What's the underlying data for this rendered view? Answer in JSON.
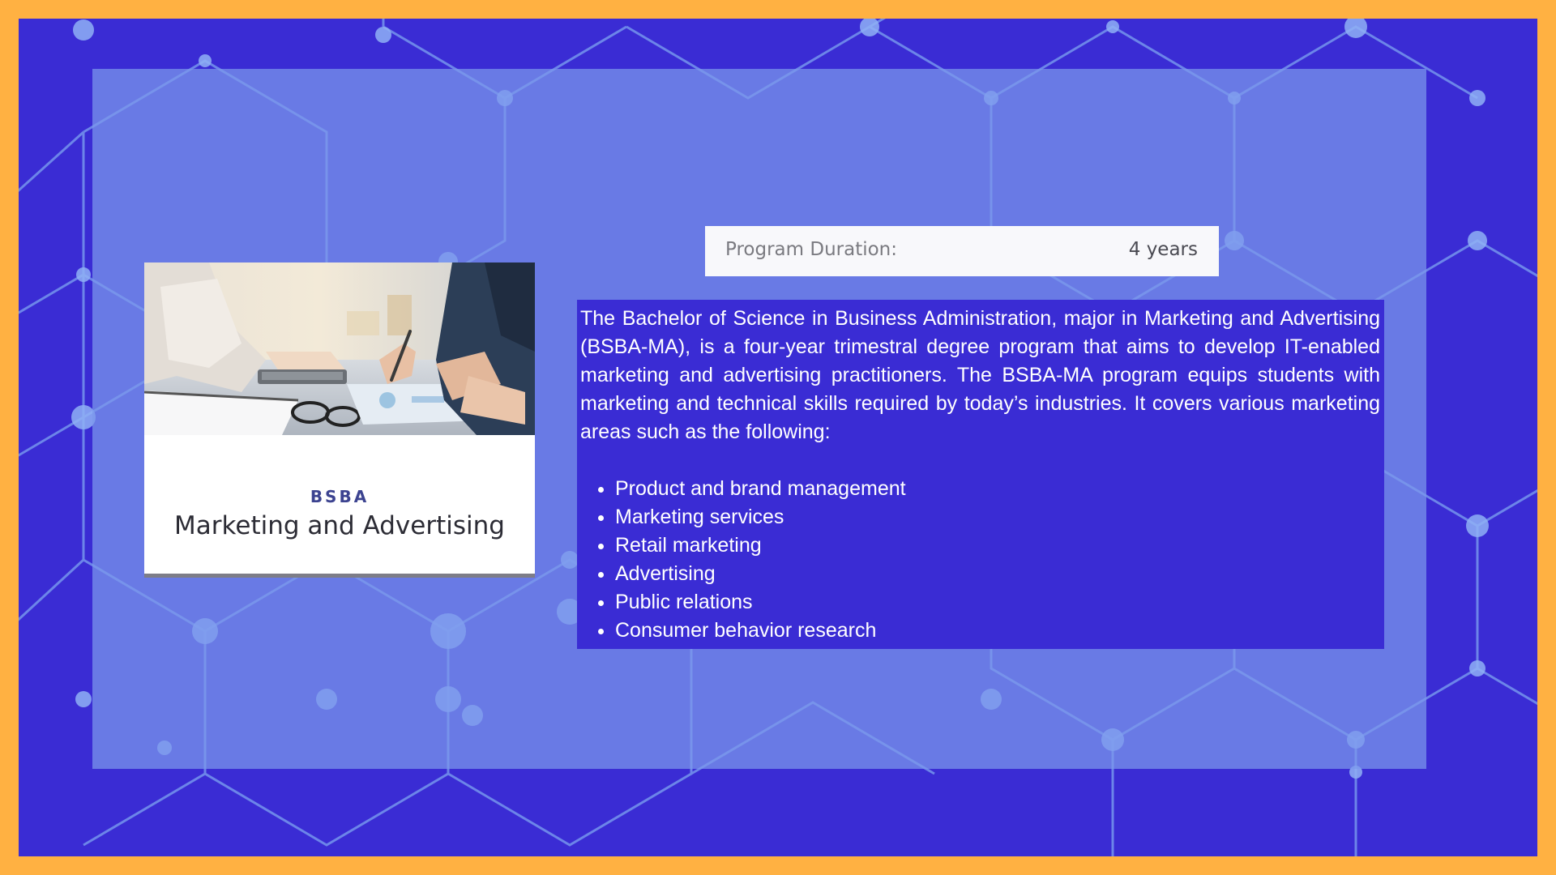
{
  "colors": {
    "border": "#ffb142",
    "background": "#3a2cd4",
    "panel": "#7c98ec",
    "text_box": "#3a2cd4",
    "card_tag": "#3c4390"
  },
  "card": {
    "image": "business-meeting-photo",
    "tag": "BSBA",
    "title": "Marketing and Advertising"
  },
  "duration": {
    "label": "Program Duration:",
    "value": "4 years"
  },
  "description": {
    "paragraph": "The Bachelor of Science in Business Administration, major in Marketing and Advertising (BSBA-MA), is a four-year trimestral degree program that aims to develop IT-enabled marketing and advertising practitioners. The BSBA-MA program equips students with marketing and technical skills required by today’s industries. It covers various marketing areas such as the following:",
    "areas": [
      "Product and brand management",
      "Marketing services",
      "Retail marketing",
      "Advertising",
      "Public relations",
      "Consumer behavior research"
    ]
  }
}
